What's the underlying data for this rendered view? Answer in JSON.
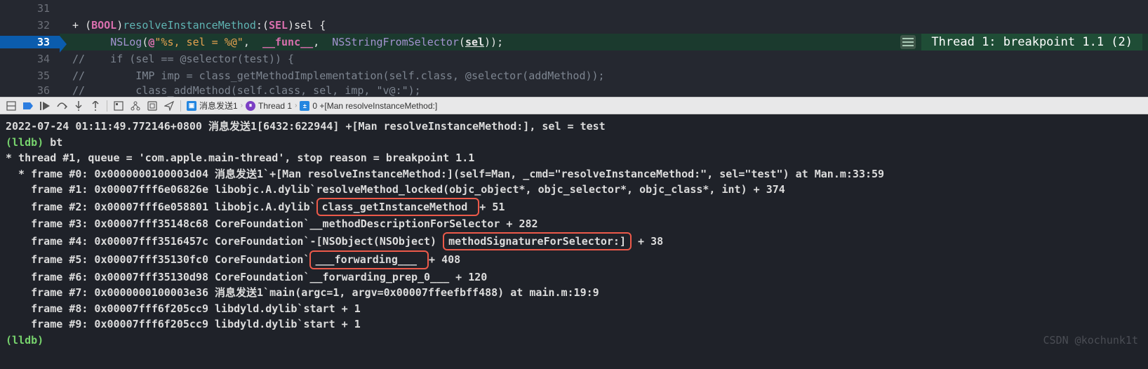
{
  "editor": {
    "lines": [
      "31",
      "32",
      "33",
      "34",
      "35",
      "36"
    ],
    "l32": {
      "plus": "+ ",
      "paren1": "(",
      "bool": "BOOL",
      "paren2": ")",
      "method": "resolveInstanceMethod",
      "colon": ":",
      "paren3": "(",
      "sel_type": "SEL",
      "paren4": ")",
      "param": "sel ",
      "brace": "{"
    },
    "l33": {
      "indent": "      ",
      "nslog": "NSLog",
      "paren": "(",
      "at": "@",
      "str": "\"%s, sel = %@\"",
      "comma1": ",  ",
      "func": "__func__",
      "comma2": ",  ",
      "nsstr": "NSStringFromSelector",
      "paren2": "(",
      "sel": "sel",
      "paren3": "))",
      "semi": ";"
    },
    "l34": "//    if (sel == @selector(test)) {",
    "l35": "//        IMP imp = class_getMethodImplementation(self.class, @selector(addMethod));",
    "l36": "//        class_addMethod(self.class, sel, imp, \"v@:\");"
  },
  "breakpoint_indicator": "Thread 1: breakpoint 1.1 (2)",
  "breadcrumb": {
    "app": "消息发送1",
    "thread": "Thread 1",
    "frame": "0 +[Man resolveInstanceMethod:]"
  },
  "console": {
    "log": "2022-07-24 01:11:49.772146+0800 消息发送1[6432:622944] +[Man resolveInstanceMethod:], sel = test",
    "prompt1": "(lldb) ",
    "bt": "bt",
    "t1": "* thread #1, queue = 'com.apple.main-thread', stop reason = breakpoint 1.1",
    "f0": "  * frame #0: 0x0000000100003d04 消息发送1`+[Man resolveInstanceMethod:](self=Man, _cmd=\"resolveInstanceMethod:\", sel=\"test\") at Man.m:33:59",
    "f1": "    frame #1: 0x00007fff6e06826e libobjc.A.dylib`resolveMethod_locked(objc_object*, objc_selector*, objc_class*, int) + 374",
    "f2a": "    frame #2: 0x00007fff6e058801 libobjc.A.dylib`",
    "f2b": "class_getInstanceMethod ",
    "f2c": "+ 51",
    "f3": "    frame #3: 0x00007fff35148c68 CoreFoundation`__methodDescriptionForSelector + 282",
    "f4a": "    frame #4: 0x00007fff3516457c CoreFoundation`-[NSObject(NSObject) ",
    "f4b": "methodSignatureForSelector:]",
    "f4c": " + 38",
    "f5a": "    frame #5: 0x00007fff35130fc0 CoreFoundation`",
    "f5b": "___forwarding___ ",
    "f5c": "+ 408",
    "f6": "    frame #6: 0x00007fff35130d98 CoreFoundation`__forwarding_prep_0___ + 120",
    "f7": "    frame #7: 0x0000000100003e36 消息发送1`main(argc=1, argv=0x00007ffeefbff488) at main.m:19:9",
    "f8": "    frame #8: 0x00007fff6f205cc9 libdyld.dylib`start + 1",
    "f9": "    frame #9: 0x00007fff6f205cc9 libdyld.dylib`start + 1",
    "prompt2": "(lldb)"
  },
  "watermark": "CSDN @kochunk1t"
}
